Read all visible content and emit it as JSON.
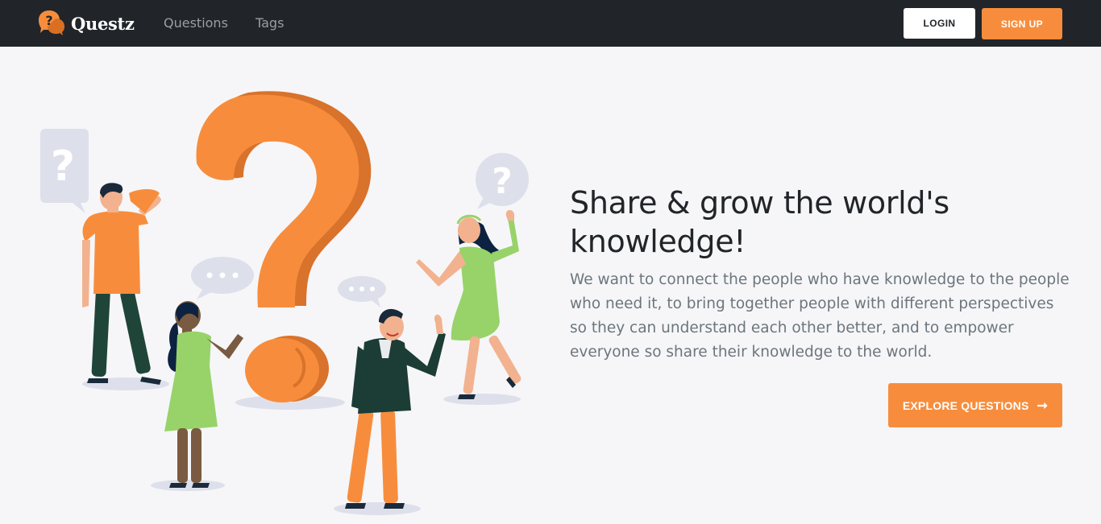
{
  "brand": {
    "name": "Questz",
    "logo_icon": "question-bubble-icon"
  },
  "nav": {
    "links": [
      {
        "label": "Questions"
      },
      {
        "label": "Tags"
      }
    ],
    "login_label": "LOGIN",
    "signup_label": "SIGN UP"
  },
  "hero": {
    "title": "Share & grow the world's knowledge!",
    "description": "We want to connect the people who have knowledge to the people who need it, to bring together people with different perspectives so they can understand each other better, and to empower everyone so share their knowledge to the world.",
    "cta_label": "EXPLORE QUESTIONS",
    "cta_icon": "arrow-right-icon"
  },
  "colors": {
    "navbar": "#212529",
    "accent": "#f78d3c",
    "page_bg": "#f6f6f8",
    "muted_text": "#6c757d"
  }
}
